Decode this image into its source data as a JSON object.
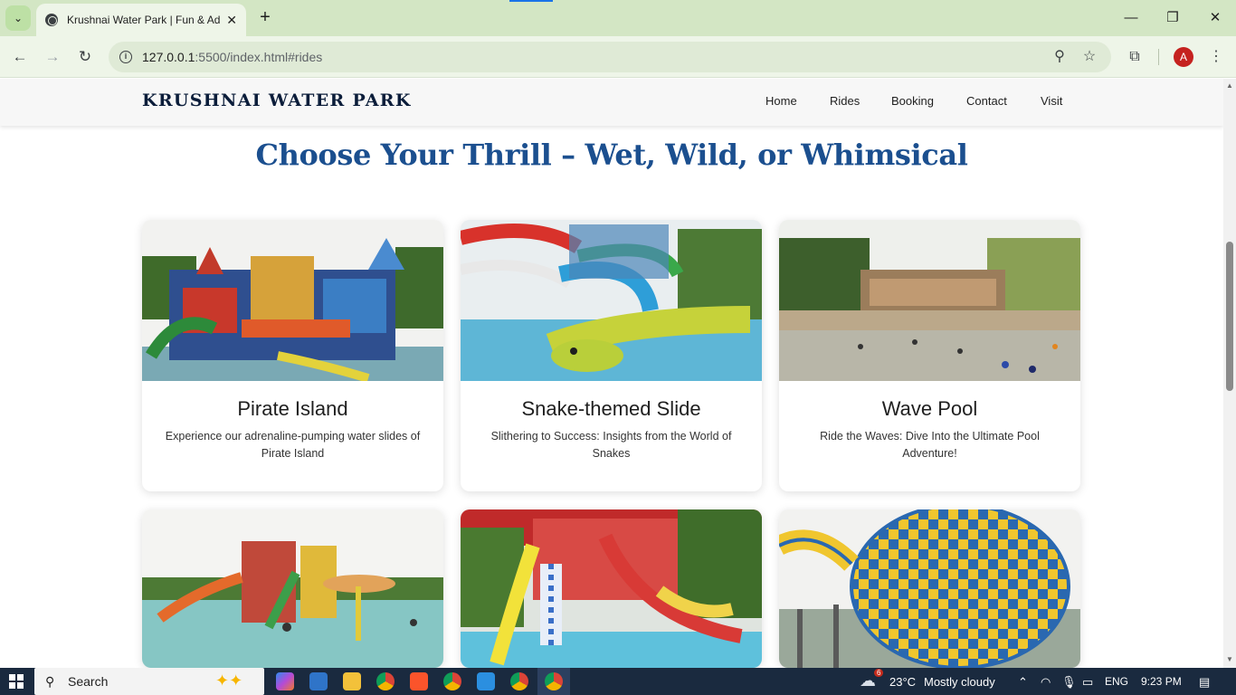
{
  "browser": {
    "tab_title": "Krushnai Water Park | Fun & Ad",
    "url_main": "127.0.0.1",
    "url_rest": ":5500/index.html#rides"
  },
  "site": {
    "brand": "KRUSHNAI WATER PARK",
    "nav": [
      "Home",
      "Rides",
      "Booking",
      "Contact",
      "Visit"
    ]
  },
  "section": {
    "title": "Choose Your Thrill – Wet, Wild, or Whimsical"
  },
  "rides": [
    {
      "title": "Pirate Island",
      "desc": "Experience our adrenaline-pumping water slides of Pirate Island"
    },
    {
      "title": "Snake-themed Slide",
      "desc": "Slithering to Success: Insights from the World of Snakes"
    },
    {
      "title": "Wave Pool",
      "desc": "Ride the Waves: Dive Into the Ultimate Pool Adventure!"
    }
  ],
  "taskbar": {
    "search_label": "Search",
    "weather_temp": "23°C",
    "weather_text": "Mostly cloudy",
    "weather_badge": "6",
    "language": "ENG",
    "time": "9:23 PM"
  },
  "profile": {
    "initial": "A"
  },
  "colors": {
    "accent": "#1b4f8f",
    "chrome_bg": "#d3e6c4",
    "taskbar": "#1a2a3f"
  }
}
